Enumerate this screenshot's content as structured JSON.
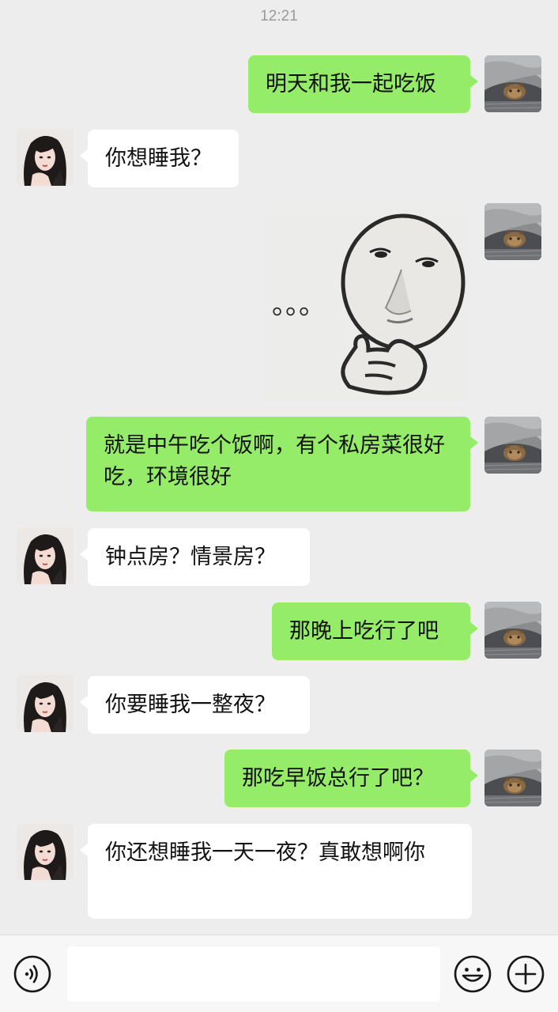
{
  "status_bar": {
    "time": "12:21"
  },
  "contacts": {
    "self_avatar": "cat-under-blanket-avatar",
    "other_avatar": "woman-portrait-avatar"
  },
  "messages": [
    {
      "from": "self",
      "type": "text",
      "text": "明天和我一起吃饭"
    },
    {
      "from": "other",
      "type": "text",
      "text": "你想睡我？"
    },
    {
      "from": "self",
      "type": "sticker",
      "sticker": "thinking-face-sticker",
      "sticker_text": "。。。"
    },
    {
      "from": "self",
      "type": "text",
      "text": "就是中午吃个饭啊，有个私房菜很好吃，环境很好"
    },
    {
      "from": "other",
      "type": "text",
      "text": "钟点房？情景房？"
    },
    {
      "from": "self",
      "type": "text",
      "text": "那晚上吃行了吧"
    },
    {
      "from": "other",
      "type": "text",
      "text": "你要睡我一整夜？"
    },
    {
      "from": "self",
      "type": "text",
      "text": "那吃早饭总行了吧？"
    },
    {
      "from": "other",
      "type": "text",
      "text": "你还想睡我一天一夜？真敢想啊你"
    }
  ],
  "input_bar": {
    "voice_icon": "voice-icon",
    "input_value": "",
    "emoji_icon": "emoji-icon",
    "more_icon": "plus-icon"
  },
  "colors": {
    "background": "#ededed",
    "sent_bubble": "#95ec69",
    "received_bubble": "#ffffff",
    "timestamp": "#9a9a9a"
  }
}
